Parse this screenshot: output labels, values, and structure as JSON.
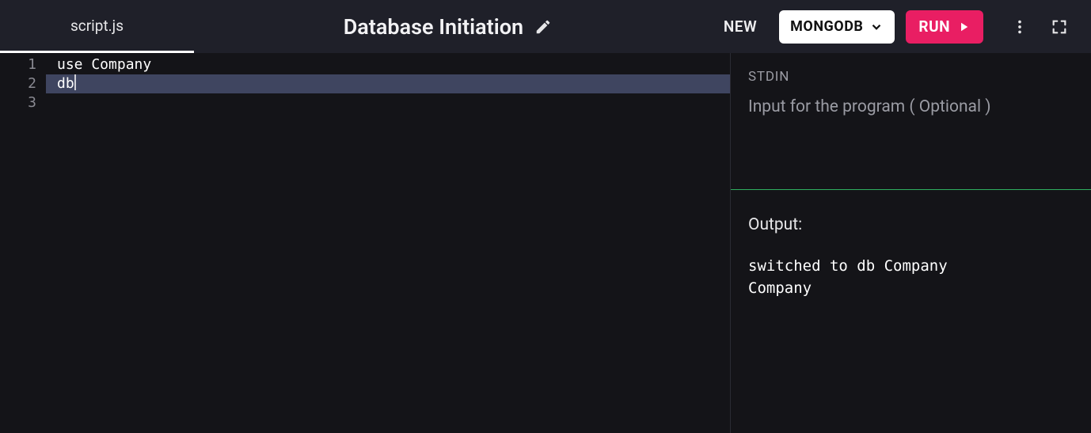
{
  "tab": {
    "filename": "script.js"
  },
  "header": {
    "title": "Database Initiation",
    "new_label": "NEW",
    "language_label": "MONGODB",
    "run_label": "RUN"
  },
  "editor": {
    "lines": [
      "use Company",
      "db",
      ""
    ],
    "line_numbers": [
      "1",
      "2",
      "3"
    ],
    "active_line_index": 1
  },
  "io": {
    "stdin_label": "STDIN",
    "stdin_placeholder": "Input for the program ( Optional )",
    "stdin_value": "",
    "output_label": "Output:",
    "output_text": "switched to db Company\nCompany"
  }
}
